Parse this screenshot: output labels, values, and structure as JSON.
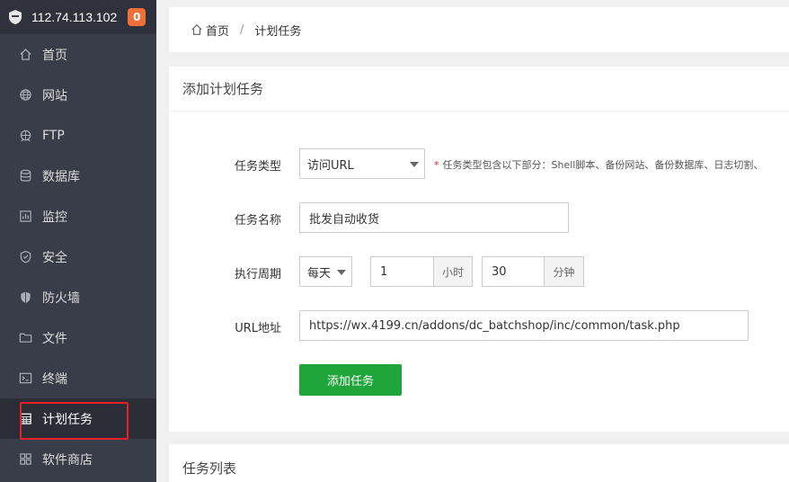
{
  "sidebar": {
    "ip": "112.74.113.102",
    "badge": "0",
    "items": [
      {
        "label": "首页",
        "icon": "home-icon"
      },
      {
        "label": "网站",
        "icon": "globe-icon"
      },
      {
        "label": "FTP",
        "icon": "ftp-icon"
      },
      {
        "label": "数据库",
        "icon": "database-icon"
      },
      {
        "label": "监控",
        "icon": "monitor-icon"
      },
      {
        "label": "安全",
        "icon": "shield-icon"
      },
      {
        "label": "防火墙",
        "icon": "firewall-icon"
      },
      {
        "label": "文件",
        "icon": "folder-icon"
      },
      {
        "label": "终端",
        "icon": "terminal-icon"
      },
      {
        "label": "计划任务",
        "icon": "calendar-icon"
      },
      {
        "label": "软件商店",
        "icon": "grid-icon"
      }
    ]
  },
  "breadcrumb": {
    "home": "首页",
    "separator": "/",
    "current": "计划任务"
  },
  "form": {
    "title": "添加计划任务",
    "task_type_label": "任务类型",
    "task_type_value": "访问URL",
    "task_type_hint": "任务类型包含以下部分：Shell脚本、备份网站、备份数据库、日志切割、",
    "task_type_hint_star": "*",
    "task_name_label": "任务名称",
    "task_name_value": "批发自动收货",
    "cycle_label": "执行周期",
    "cycle_value": "每天",
    "hour_value": "1",
    "hour_unit": "小时",
    "minute_value": "30",
    "minute_unit": "分钟",
    "url_label": "URL地址",
    "url_value": "https://wx.4199.cn/addons/dc_batchshop/inc/common/task.php",
    "submit_label": "添加任务"
  },
  "task_list": {
    "title": "任务列表"
  },
  "colors": {
    "sidebar_bg": "#393d49",
    "accent_green": "#20a53a",
    "badge_orange": "#f0703a",
    "highlight_red": "#e8202a"
  }
}
